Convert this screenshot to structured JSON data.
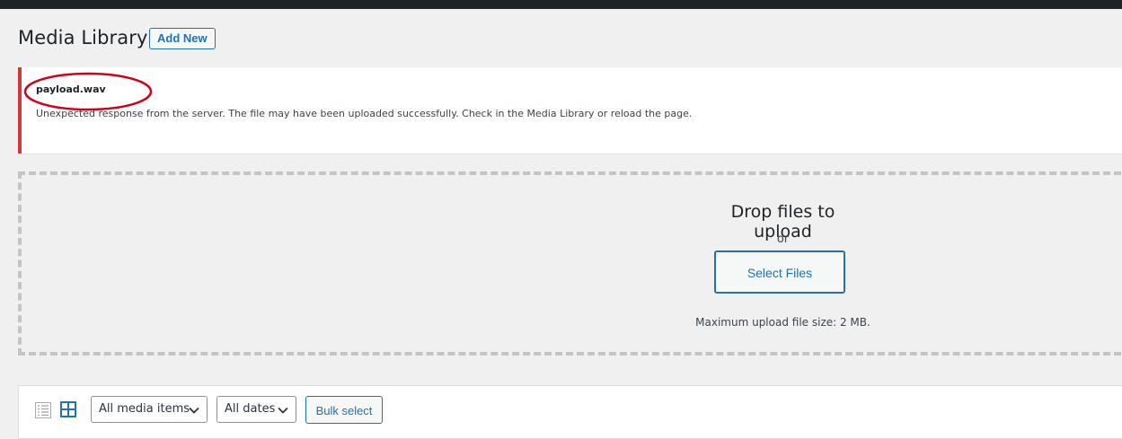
{
  "page": {
    "title": "Media Library",
    "add_new_label": "Add New"
  },
  "notice": {
    "filename": "payload.wav",
    "message": "Unexpected response from the server. The file may have been uploaded successfully. Check in the Media Library or reload the page.",
    "border_color": "#d63638",
    "annotation_color": "#d0021b"
  },
  "uploader": {
    "title": "Drop files to upload",
    "or_text": "or",
    "select_files_label": "Select Files",
    "max_size_text": "Maximum upload file size: 2 MB."
  },
  "toolbar": {
    "list_view_icon": "list-view-icon",
    "grid_view_icon": "grid-view-icon",
    "type_filter": "All media items",
    "date_filter": "All dates",
    "bulk_select_label": "Bulk select"
  },
  "colors": {
    "accent": "#2271b1",
    "admin_bar": "#1d2327",
    "background": "#f0f0f1"
  }
}
